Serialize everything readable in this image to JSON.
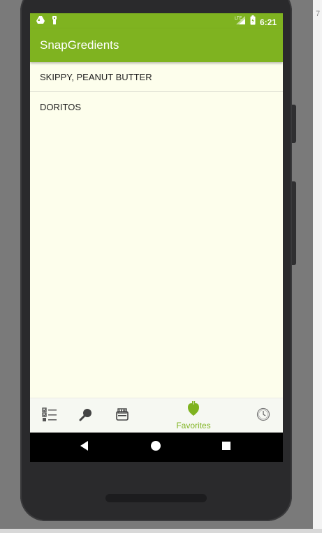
{
  "status_bar": {
    "time": "6:21",
    "left_icons": [
      "drive-icon",
      "key-icon"
    ],
    "right_icons": [
      "signal-icon",
      "battery-icon"
    ]
  },
  "app_bar": {
    "title": "SnapGredients"
  },
  "favorites_list": {
    "items": [
      {
        "label": "SKIPPY, PEANUT BUTTER"
      },
      {
        "label": "DORITOS"
      }
    ]
  },
  "bottom_nav": {
    "items": [
      {
        "icon": "checklist-icon",
        "label": ""
      },
      {
        "icon": "search-icon",
        "label": ""
      },
      {
        "icon": "barcode-scanner-icon",
        "label": ""
      },
      {
        "icon": "heart-icon",
        "label": "Favorites",
        "active": true
      },
      {
        "icon": "history-clock-icon",
        "label": ""
      }
    ]
  },
  "system_nav": {
    "buttons": [
      "back-icon",
      "home-icon",
      "recents-icon"
    ]
  },
  "colors": {
    "primary": "#7fb320",
    "background": "#fdfeec",
    "text": "#1f1f1f"
  }
}
